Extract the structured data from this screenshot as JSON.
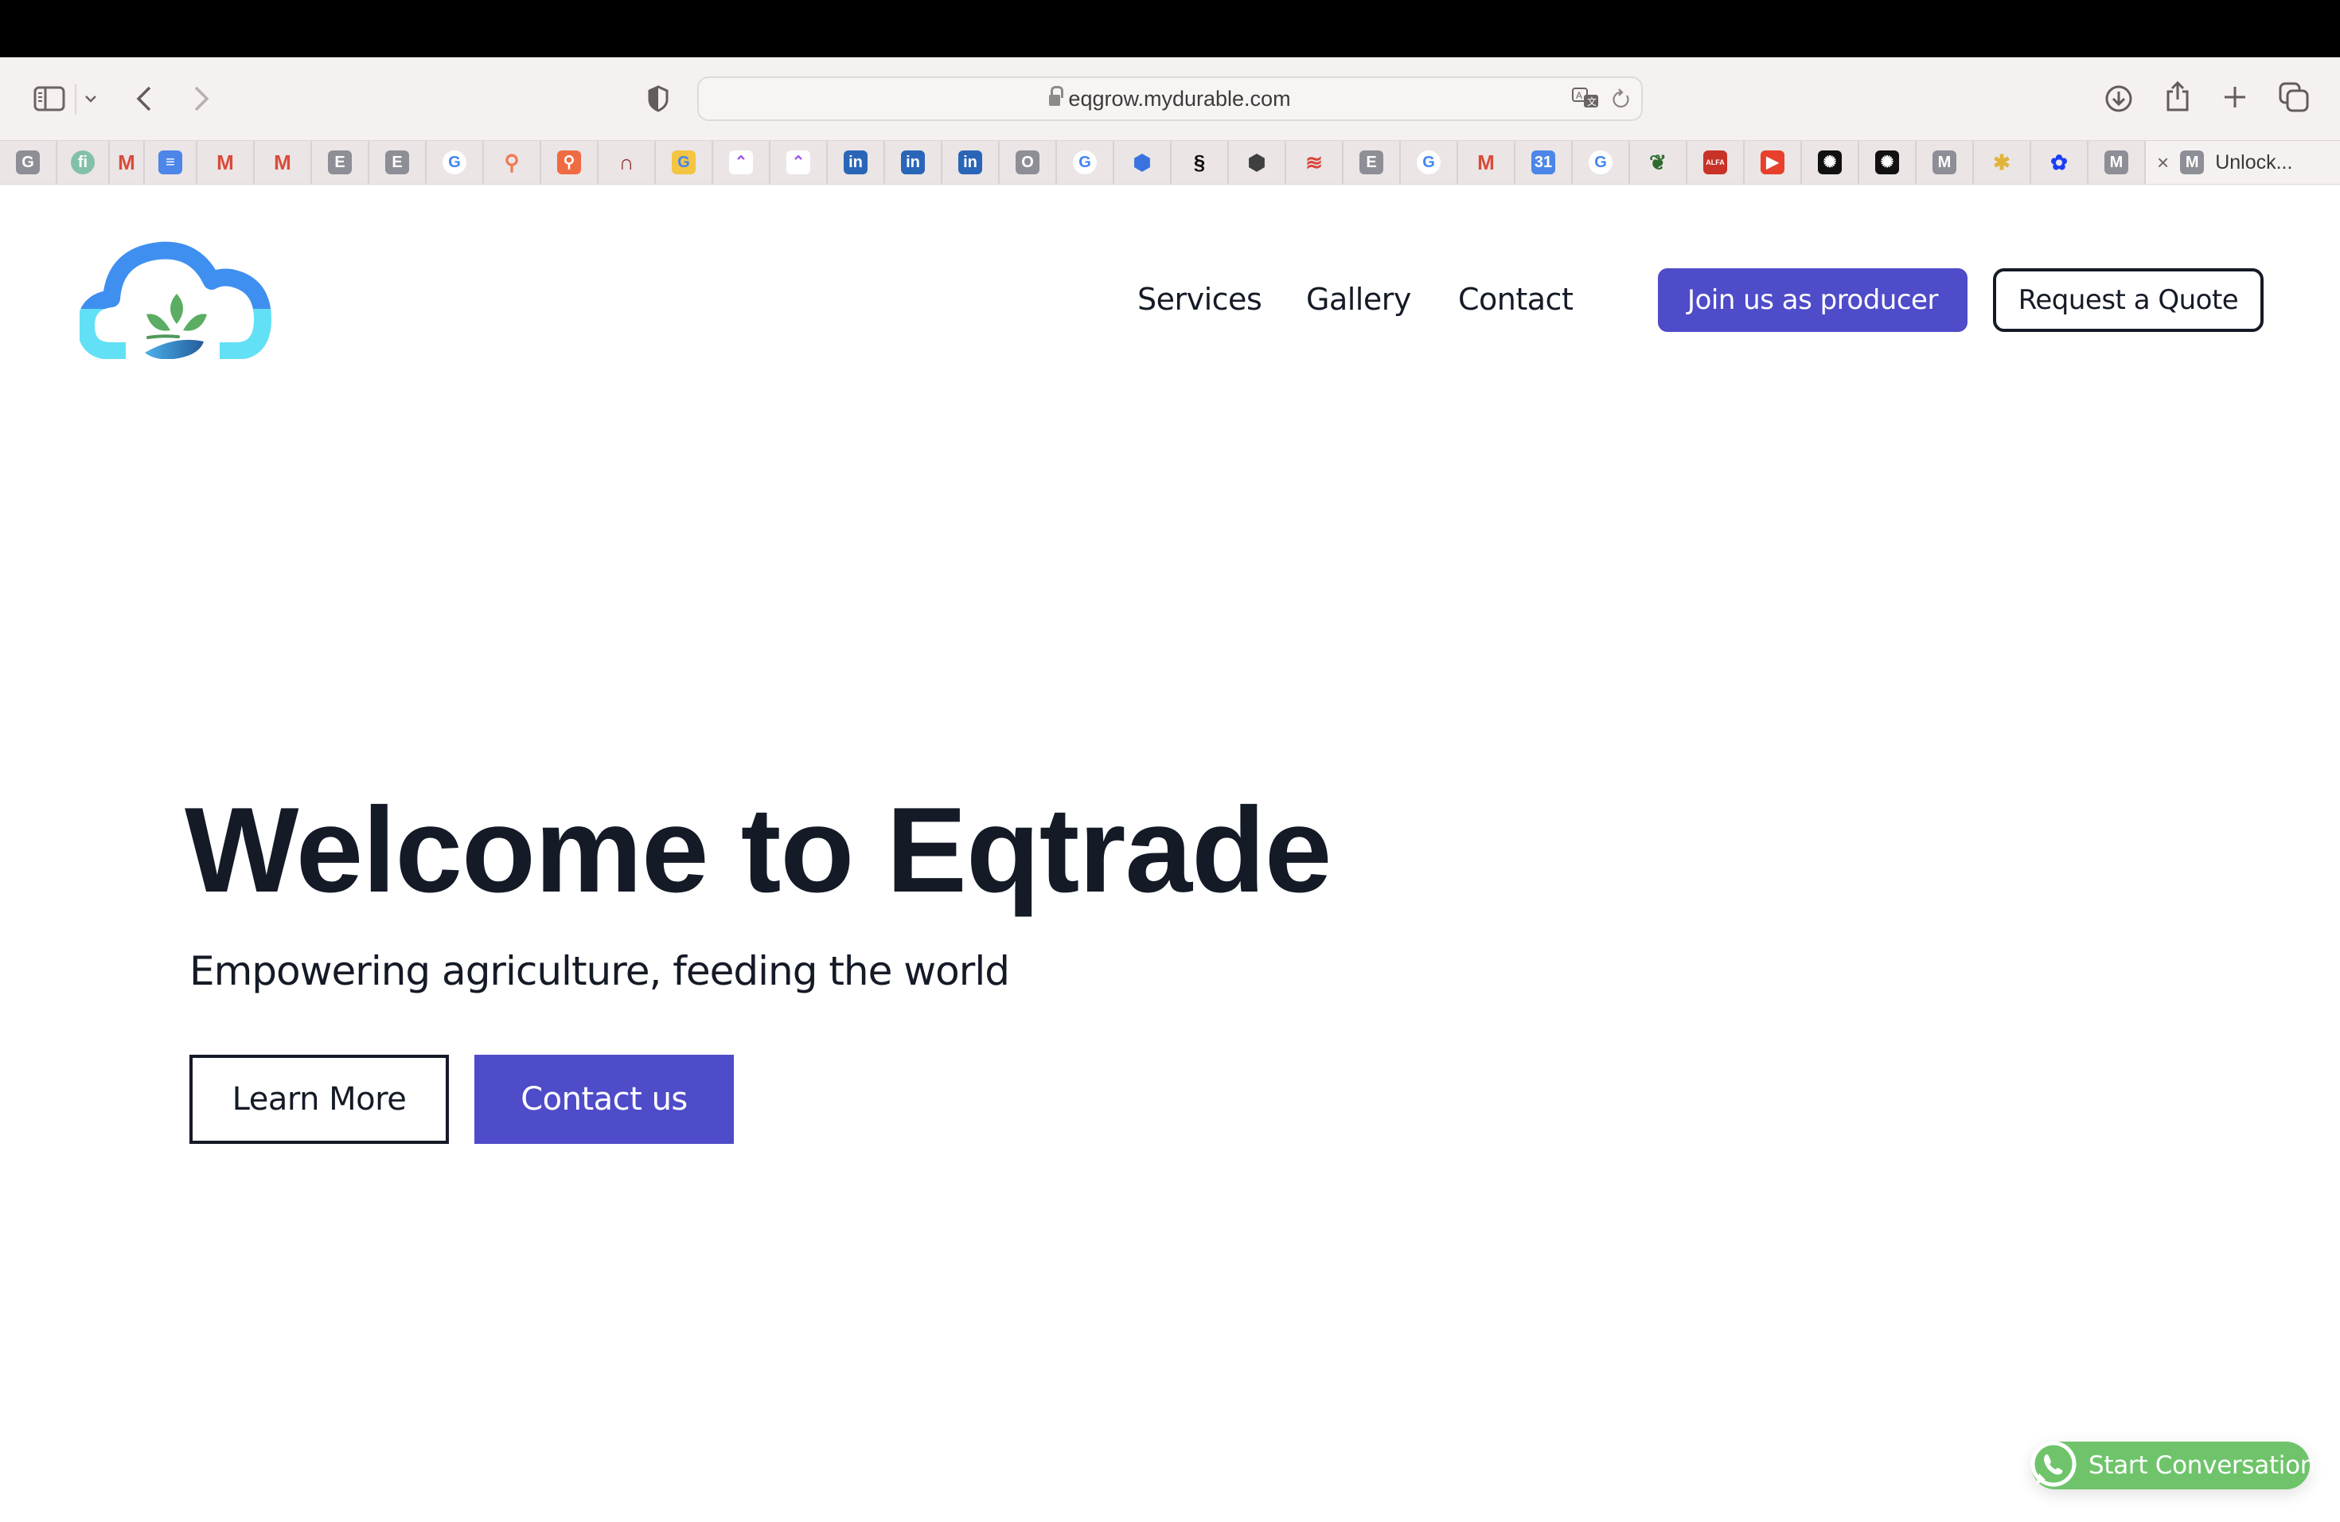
{
  "browser": {
    "url": "eqgrow.mydurable.com",
    "toolbar": {
      "sidebar_icon": "sidebar-icon",
      "tab_groups_chevron": "chevron-down-icon",
      "back_icon": "chevron-left-icon",
      "forward_icon": "chevron-right-icon",
      "privacy_icon": "shield-icon",
      "translate_icon": "translate-icon",
      "reload_icon": "reload-icon",
      "download_icon": "download-icon",
      "share_icon": "share-icon",
      "new_tab_icon": "plus-icon",
      "tab_overview_icon": "tab-overview-icon"
    },
    "pinned_tabs": [
      {
        "favicon": "G",
        "name": "g-gray",
        "bg": "#8e8e96",
        "fg": "#ffffff"
      },
      {
        "favicon": "fi",
        "name": "fi-green",
        "bg": "#82c1a8",
        "fg": "#ffffff"
      },
      {
        "favicon": "M",
        "name": "gmail",
        "bg": "transparent",
        "fg": "#d94b3b"
      },
      {
        "favicon": "≡",
        "name": "google-docs",
        "bg": "#4c86e8",
        "fg": "#ffffff"
      },
      {
        "favicon": "M",
        "name": "gmail",
        "bg": "transparent",
        "fg": "#d94b3b"
      },
      {
        "favicon": "M",
        "name": "gmail",
        "bg": "transparent",
        "fg": "#d94b3b"
      },
      {
        "favicon": "E",
        "name": "e-gray",
        "bg": "#8e8e96",
        "fg": "#ffffff"
      },
      {
        "favicon": "E",
        "name": "e-gray",
        "bg": "#8e8e96",
        "fg": "#ffffff"
      },
      {
        "favicon": "G",
        "name": "google",
        "bg": "#ffffff",
        "fg": "#4285f4"
      },
      {
        "favicon": "⚲",
        "name": "hubspot",
        "bg": "transparent",
        "fg": "#f07950"
      },
      {
        "favicon": "⚲",
        "name": "hubspot-square",
        "bg": "#ef6b43",
        "fg": "#ffffff"
      },
      {
        "favicon": "∩",
        "name": "arch",
        "bg": "transparent",
        "fg": "#8b2a24"
      },
      {
        "favicon": "G",
        "name": "google-tag",
        "bg": "#f4c542",
        "fg": "#4285f4"
      },
      {
        "favicon": "⌃",
        "name": "clickup",
        "bg": "#ffffff",
        "fg": "#a158e6"
      },
      {
        "favicon": "⌃",
        "name": "clickup",
        "bg": "#ffffff",
        "fg": "#a158e6"
      },
      {
        "favicon": "in",
        "name": "linkedin",
        "bg": "#2a66b8",
        "fg": "#ffffff"
      },
      {
        "favicon": "in",
        "name": "linkedin",
        "bg": "#2a66b8",
        "fg": "#ffffff"
      },
      {
        "favicon": "in",
        "name": "linkedin",
        "bg": "#2a66b8",
        "fg": "#ffffff"
      },
      {
        "favicon": "O",
        "name": "o-gray",
        "bg": "#8e8e96",
        "fg": "#ffffff"
      },
      {
        "favicon": "G",
        "name": "google",
        "bg": "#ffffff",
        "fg": "#4285f4"
      },
      {
        "favicon": "⬢",
        "name": "blue-hexagon",
        "bg": "transparent",
        "fg": "#3a73e0"
      },
      {
        "favicon": "§",
        "name": "squarespace",
        "bg": "transparent",
        "fg": "#111111"
      },
      {
        "favicon": "⬢",
        "name": "dark-cube",
        "bg": "transparent",
        "fg": "#3f3f3f"
      },
      {
        "favicon": "≋",
        "name": "wto",
        "bg": "transparent",
        "fg": "#d9453a"
      },
      {
        "favicon": "E",
        "name": "e-gray",
        "bg": "#8e8e96",
        "fg": "#ffffff"
      },
      {
        "favicon": "G",
        "name": "google",
        "bg": "#ffffff",
        "fg": "#4285f4"
      },
      {
        "favicon": "M",
        "name": "gmail",
        "bg": "transparent",
        "fg": "#d94b3b"
      },
      {
        "favicon": "31",
        "name": "google-calendar",
        "bg": "#4c86e8",
        "fg": "#ffffff"
      },
      {
        "favicon": "G",
        "name": "google",
        "bg": "#ffffff",
        "fg": "#4285f4"
      },
      {
        "favicon": "❦",
        "name": "avocado",
        "bg": "transparent",
        "fg": "#2f6b2e"
      },
      {
        "favicon": "ALFA",
        "name": "alfa",
        "bg": "#c83227",
        "fg": "#ffffff"
      },
      {
        "favicon": "▶",
        "name": "youtube",
        "bg": "#e8402c",
        "fg": "#ffffff"
      },
      {
        "favicon": "✺",
        "name": "chatgpt",
        "bg": "#111111",
        "fg": "#ffffff"
      },
      {
        "favicon": "✺",
        "name": "chatgpt",
        "bg": "#111111",
        "fg": "#ffffff"
      },
      {
        "favicon": "M",
        "name": "m-gray",
        "bg": "#8e8e96",
        "fg": "#ffffff"
      },
      {
        "favicon": "✱",
        "name": "slack",
        "bg": "transparent",
        "fg": "#e0b43a"
      },
      {
        "favicon": "✿",
        "name": "blue-flower",
        "bg": "transparent",
        "fg": "#1b3ff5"
      },
      {
        "favicon": "M",
        "name": "m-gray",
        "bg": "#8e8e96",
        "fg": "#ffffff"
      }
    ],
    "active_tab": {
      "close": "×",
      "favicon": "M",
      "title": "Unlock..."
    }
  },
  "site": {
    "logo_alt": "Eqtrade cloud-and-sprout logo",
    "nav": [
      {
        "label": "Services"
      },
      {
        "label": "Gallery"
      },
      {
        "label": "Contact"
      }
    ],
    "cta_primary": "Join us as producer",
    "cta_secondary": "Request a Quote",
    "hero": {
      "title": "Welcome to Eqtrade",
      "subtitle": "Empowering agriculture, feeding the world",
      "learn_more": "Learn More",
      "contact_us": "Contact us"
    },
    "whatsapp": {
      "label": "Start Conversation",
      "icon": "whatsapp-icon"
    },
    "colors": {
      "brand": "#4f4cc9",
      "text": "#141a26",
      "whatsapp": "#6fc46b"
    }
  }
}
